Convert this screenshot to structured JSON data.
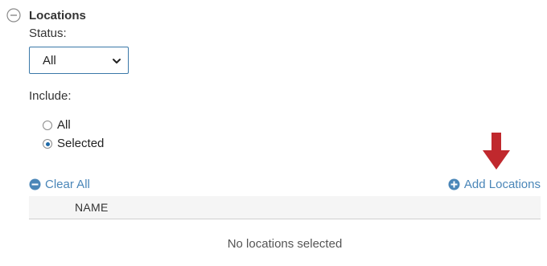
{
  "section": {
    "title": "Locations"
  },
  "status": {
    "label": "Status:",
    "selected": "All"
  },
  "include": {
    "label": "Include:",
    "options": [
      {
        "label": "All",
        "checked": false
      },
      {
        "label": "Selected",
        "checked": true
      }
    ]
  },
  "actions": {
    "clear_all": "Clear All",
    "add_locations": "Add Locations"
  },
  "table": {
    "columns": [
      "NAME"
    ],
    "empty_message": "No locations selected"
  },
  "colors": {
    "link": "#4a86b8",
    "arrow": "#c0282d",
    "radio_checked": "#1e6aa8",
    "select_border": "#3a78a8"
  }
}
